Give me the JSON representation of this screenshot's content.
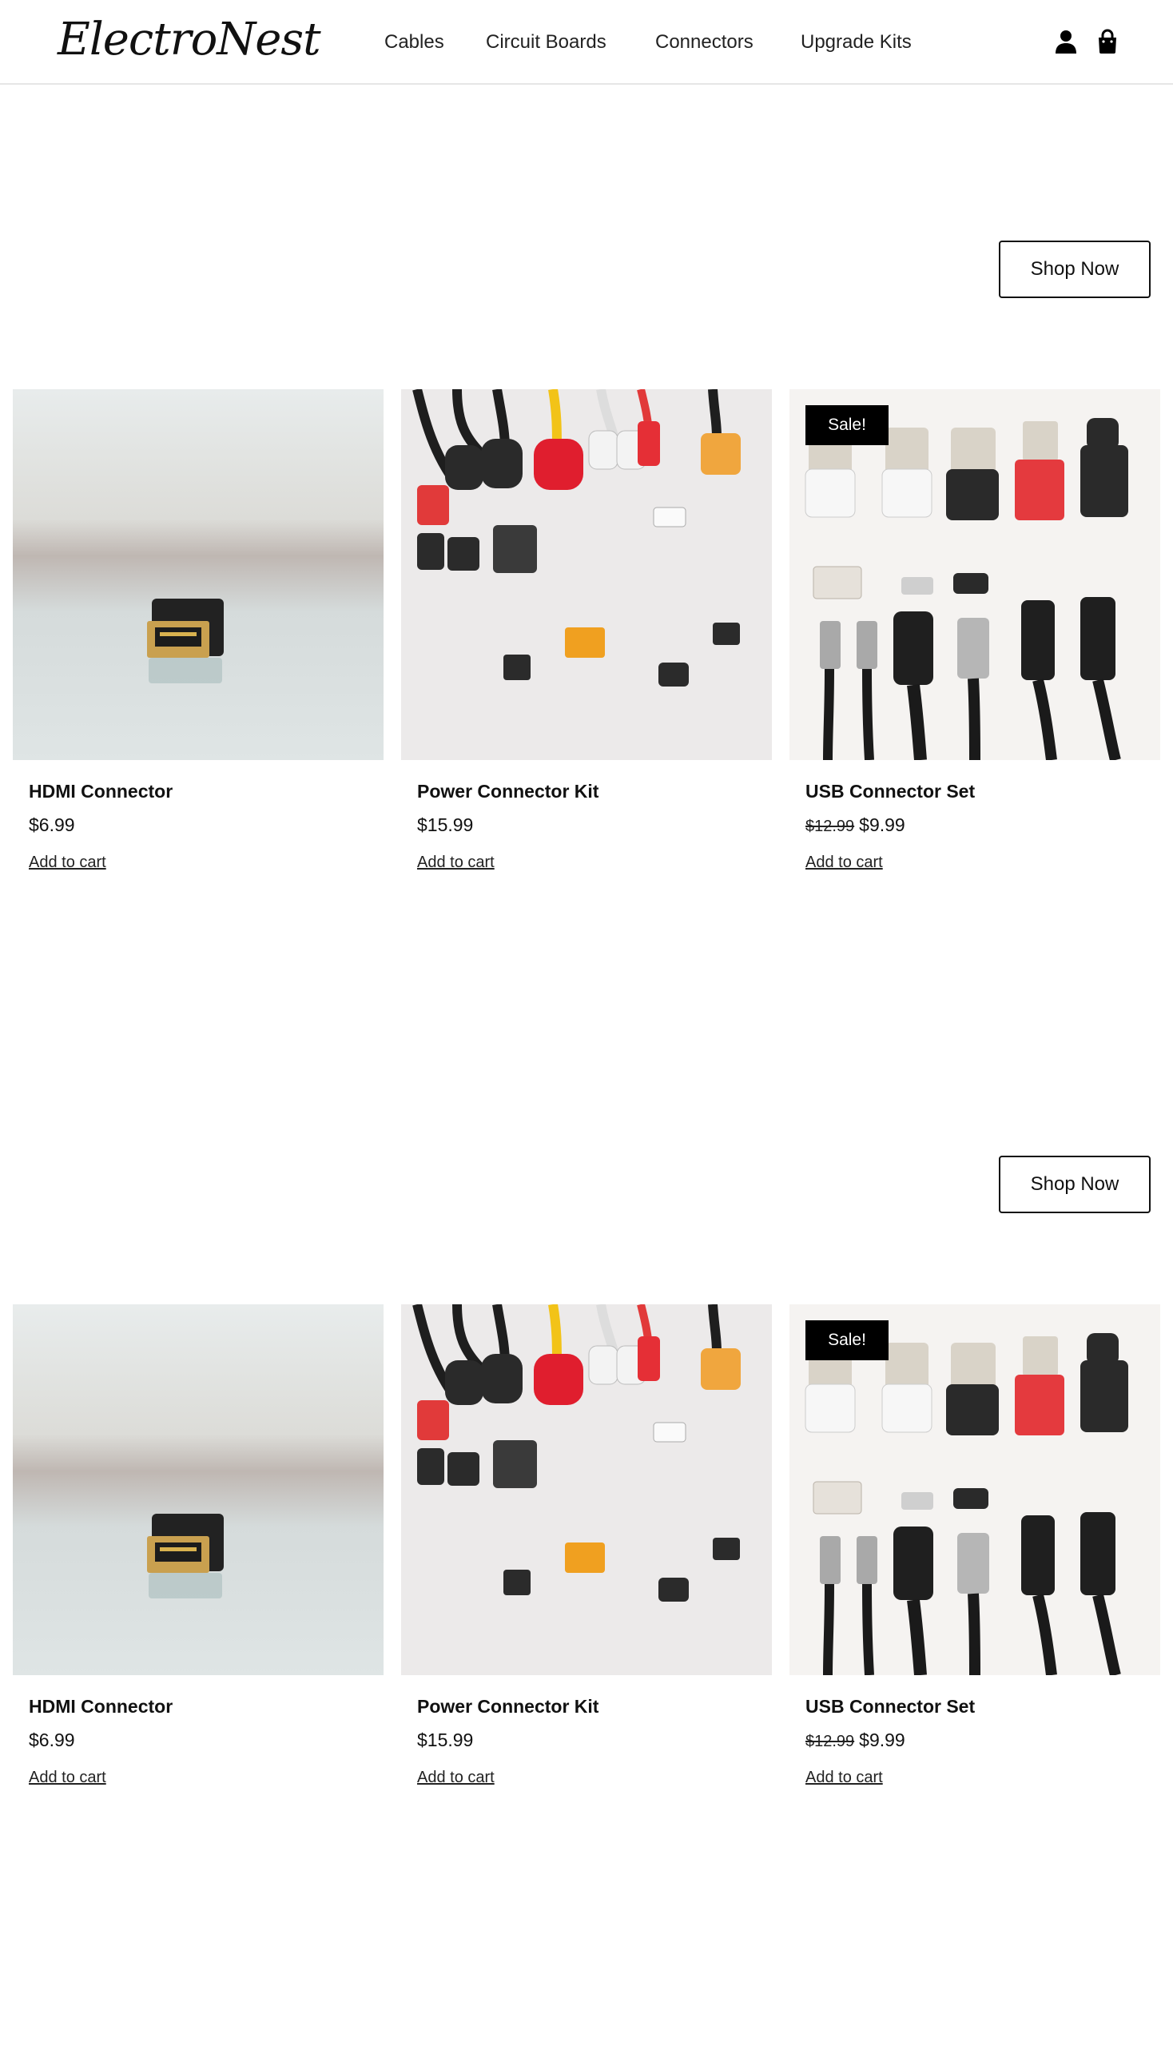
{
  "header": {
    "logo": "ElectroNest",
    "nav": [
      "Cables",
      "Circuit Boards",
      "Connectors",
      "Upgrade Kits"
    ],
    "icons": {
      "account": "person-icon",
      "cart": "shopping-bag-icon"
    }
  },
  "sections": [
    {
      "cta": "Shop Now",
      "products": [
        {
          "name": "HDMI Connector",
          "price": "$6.99",
          "old_price": "",
          "sale_badge": "",
          "add_to_cart": "Add to cart"
        },
        {
          "name": "Power Connector Kit",
          "price": "$15.99",
          "old_price": "",
          "sale_badge": "",
          "add_to_cart": "Add to cart"
        },
        {
          "name": "USB Connector Set",
          "price": "$9.99",
          "old_price": "$12.99",
          "sale_badge": "Sale!",
          "add_to_cart": "Add to cart"
        }
      ]
    },
    {
      "cta": "Shop Now",
      "products": [
        {
          "name": "HDMI Connector",
          "price": "$6.99",
          "old_price": "",
          "sale_badge": "",
          "add_to_cart": "Add to cart"
        },
        {
          "name": "Power Connector Kit",
          "price": "$15.99",
          "old_price": "",
          "sale_badge": "",
          "add_to_cart": "Add to cart"
        },
        {
          "name": "USB Connector Set",
          "price": "$9.99",
          "old_price": "$12.99",
          "sale_badge": "Sale!",
          "add_to_cart": "Add to cart"
        }
      ]
    }
  ],
  "colors": {
    "text": "#111111",
    "badge_bg": "#000000",
    "badge_text": "#ffffff",
    "header_border": "#e6e6e6"
  }
}
